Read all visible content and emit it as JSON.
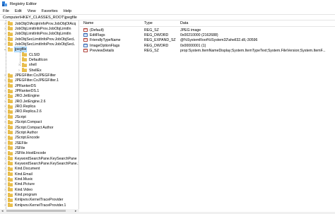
{
  "window": {
    "title": "Registry Editor"
  },
  "menu": [
    "File",
    "Edit",
    "View",
    "Favorites",
    "Help"
  ],
  "address": "Computer\\HKEY_CLASSES_ROOT\\jpegfile",
  "tree": {
    "items": [
      {
        "label": "JobObjOIAcqtnInfoProv.JobObjOIAcq",
        "level": 0,
        "expander": "›"
      },
      {
        "label": "JobObjLimitInfoProv.JobObjLimitIn",
        "level": 0,
        "expander": "›"
      },
      {
        "label": "JobObjLimitInfoProv.JobObjLimitIn",
        "level": 0,
        "expander": "›"
      },
      {
        "label": "JobObjSecLimitInfoProv.JobObjSecL",
        "level": 0,
        "expander": "›"
      },
      {
        "label": "JobObjSecLimitInfoProv.JobObjSecL",
        "level": 0,
        "expander": "›"
      },
      {
        "label": "jpegfile",
        "level": 0,
        "expander": "⌄",
        "open": true,
        "selected": true
      },
      {
        "label": "CLSID",
        "level": 1,
        "expander": ""
      },
      {
        "label": "DefaultIcon",
        "level": 1,
        "expander": ""
      },
      {
        "label": "shell",
        "level": 1,
        "expander": "›"
      },
      {
        "label": "ShellEx",
        "level": 1,
        "expander": "›"
      },
      {
        "label": "JPEGFilter.CoJPEGFilter",
        "level": 0,
        "expander": "›"
      },
      {
        "label": "JPEGFilter.CoJPEGFilter.1",
        "level": 0,
        "expander": "›"
      },
      {
        "label": "JPRankerDS",
        "level": 0,
        "expander": "›"
      },
      {
        "label": "JPRankerDS.1",
        "level": 0,
        "expander": "›"
      },
      {
        "label": "JRO.JetEngine",
        "level": 0,
        "expander": "›"
      },
      {
        "label": "JRO.JetEngine.2.6",
        "level": 0,
        "expander": "›"
      },
      {
        "label": "JRO.Replica",
        "level": 0,
        "expander": "›"
      },
      {
        "label": "JRO.Replica.2.6",
        "level": 0,
        "expander": "›"
      },
      {
        "label": "JScript",
        "level": 0,
        "expander": "›"
      },
      {
        "label": "JScript.Compact",
        "level": 0,
        "expander": "›"
      },
      {
        "label": "JScript.Compact Author",
        "level": 0,
        "expander": "›"
      },
      {
        "label": "JScript Author",
        "level": 0,
        "expander": "›"
      },
      {
        "label": "JScript.Encode",
        "level": 0,
        "expander": "›"
      },
      {
        "label": "JSEFile",
        "level": 0,
        "expander": "›"
      },
      {
        "label": "JSFile",
        "level": 0,
        "expander": "›"
      },
      {
        "label": "JSFile.HostEncode",
        "level": 0,
        "expander": "›"
      },
      {
        "label": "KeywordSearchPane.KeySearchPane",
        "level": 0,
        "expander": "›"
      },
      {
        "label": "KeywordSearchPane.KeySearchPane.1",
        "level": 0,
        "expander": "›"
      },
      {
        "label": "Kind.Document",
        "level": 0,
        "expander": "›"
      },
      {
        "label": "Kind.Email",
        "level": 0,
        "expander": "›"
      },
      {
        "label": "Kind.Music",
        "level": 0,
        "expander": "›"
      },
      {
        "label": "Kind.Picture",
        "level": 0,
        "expander": "›"
      },
      {
        "label": "Kind.Video",
        "level": 0,
        "expander": "›"
      },
      {
        "label": "Kind.program",
        "level": 0,
        "expander": "›"
      },
      {
        "label": "Kmlpvov.KernelTraceProvider",
        "level": 0,
        "expander": "›"
      },
      {
        "label": "Kmlpvov.KernelTraceProvider.1",
        "level": 0,
        "expander": "›"
      }
    ]
  },
  "columns": {
    "name": "Name",
    "type": "Type",
    "data": "Data"
  },
  "values": [
    {
      "name": "(Default)",
      "type": "REG_SZ",
      "data": "JPEG image",
      "icon": "string-value-icon"
    },
    {
      "name": "EditFlags",
      "type": "REG_DWORD",
      "data": "0x00210000 (2162688)",
      "icon": "binary-value-icon"
    },
    {
      "name": "FriendlyTypeName",
      "type": "REG_EXPAND_SZ",
      "data": "@%SystemRoot%\\System32\\shell32.dll,-30596",
      "icon": "string-value-icon"
    },
    {
      "name": "ImageOptionFlags",
      "type": "REG_DWORD",
      "data": "0x00000001 (1)",
      "icon": "binary-value-icon"
    },
    {
      "name": "PreviewDetails",
      "type": "REG_SZ",
      "data": "prop:System.ItemNameDisplay;System.ItemTypeText;System.FileVersion;System.ItemF...",
      "icon": "string-value-icon"
    }
  ],
  "colors": {
    "selection": "#cce8ff",
    "folder": "#e8bd4c"
  }
}
